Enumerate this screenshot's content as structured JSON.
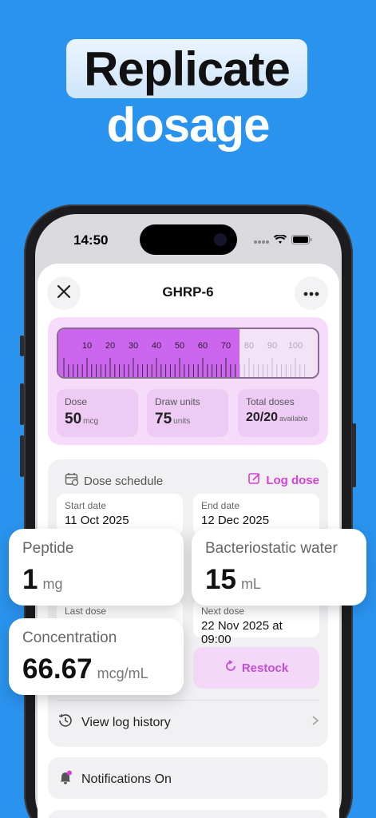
{
  "hero": {
    "line1": "Replicate",
    "line2": "dosage"
  },
  "status_bar": {
    "time": "14:50"
  },
  "header": {
    "title": "GHRP-6"
  },
  "syringe": {
    "tick_labels": [
      "10",
      "20",
      "30",
      "40",
      "50",
      "60",
      "70",
      "80",
      "90",
      "100"
    ],
    "fill_units": 75,
    "max_units": 100
  },
  "stats": [
    {
      "label": "Dose",
      "value": "50",
      "unit": "mcg"
    },
    {
      "label": "Draw units",
      "value": "75",
      "unit": "units"
    },
    {
      "label": "Total doses",
      "value": "20/20",
      "unit": "available"
    }
  ],
  "schedule": {
    "heading": "Dose schedule",
    "log_action": "Log dose",
    "start_label": "Start date",
    "start_value": "11 Oct 2025",
    "end_label": "End date",
    "end_value": "12 Dec 2025",
    "last_label": "Last dose",
    "next_label": "Next dose",
    "next_value": "22 Nov 2025 at 09:00",
    "restock": "Restock"
  },
  "log_history": "View log history",
  "notifications": "Notifications On",
  "cards": {
    "peptide": {
      "label": "Peptide",
      "value": "1",
      "unit": "mg"
    },
    "water": {
      "label": "Bacteriostatic water",
      "value": "15",
      "unit": "mL"
    },
    "concentration": {
      "label": "Concentration",
      "value": "66.67",
      "unit": "mcg/mL"
    }
  },
  "colors": {
    "background": "#2a93ee",
    "accent": "#d540d8",
    "fill": "#cc66ee"
  }
}
